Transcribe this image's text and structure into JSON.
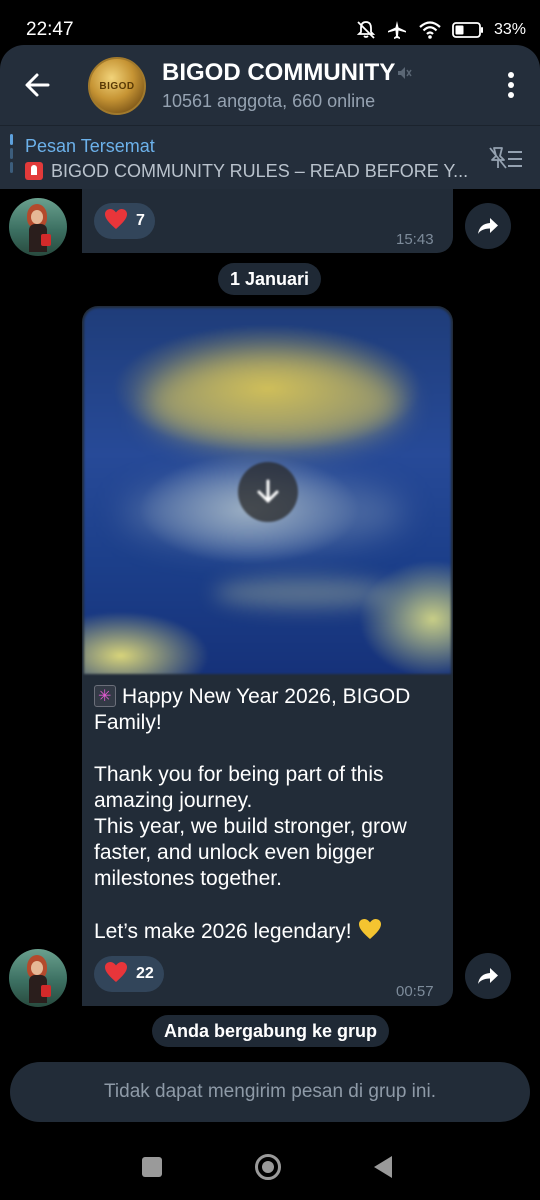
{
  "status_bar": {
    "time": "22:47",
    "battery": "33%",
    "icons": [
      "bell-off-icon",
      "airplane-icon",
      "wifi-icon",
      "battery-icon"
    ]
  },
  "header": {
    "title": "BIGOD COMMUNITY",
    "subtitle": "10561 anggota, 660 online",
    "avatar_text": "BIGOD"
  },
  "pinned": {
    "title": "Pesan Tersemat",
    "text": "BIGOD COMMUNITY RULES – READ BEFORE Y..."
  },
  "messages": [
    {
      "reaction_count": "7",
      "time": "15:43"
    },
    {
      "caption_line1": "Happy New Year 2026, BIGOD Family!",
      "caption_body": "Thank you for being part of this amazing journey.\nThis year, we build stronger, grow faster, and unlock even bigger milestones together.",
      "caption_end": "Let’s make 2026 legendary!",
      "reaction_count": "22",
      "time": "00:57"
    }
  ],
  "date_separator": "1 Januari",
  "service_message": "Anda bergabung ke grup",
  "input": {
    "notice": "Tidak dapat mengirim pesan di grup ini."
  },
  "colors": {
    "header_bg": "#242e3b",
    "bubble_bg": "#222c38",
    "accent": "#6cb1ea",
    "reaction_heart": "#e8353a"
  }
}
